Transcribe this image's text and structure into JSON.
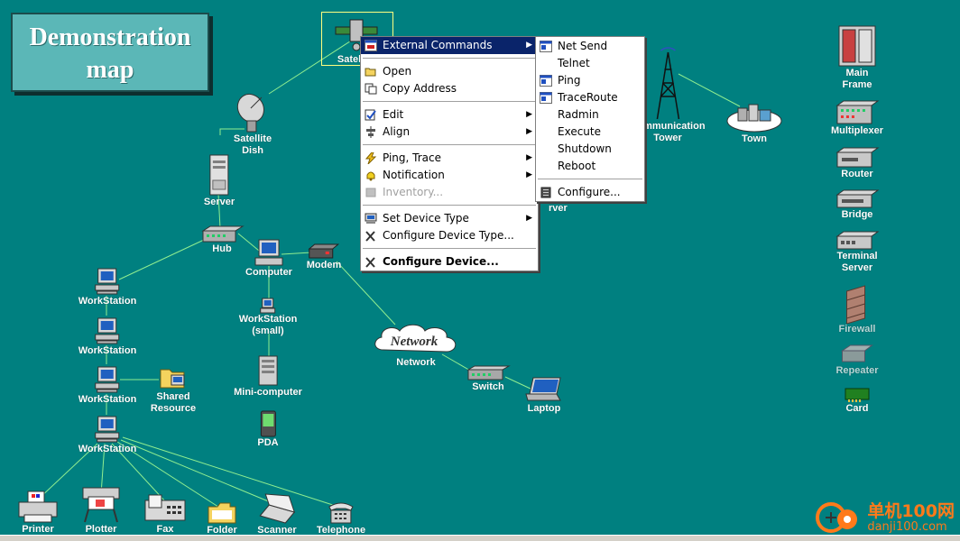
{
  "title": "Demonstration\nmap",
  "colors": {
    "background": "#008080",
    "menu_highlight": "#0a246a",
    "link": "#90ee90",
    "selection": "#ffff80"
  },
  "nodes": {
    "satellite": "Satellite",
    "satellite_dish": "Satellite\nDish",
    "server": "Server",
    "hub": "Hub",
    "computer": "Computer",
    "modem": "Modem",
    "ws1": "WorkStation",
    "ws2": "WorkStation",
    "ws3": "WorkStation",
    "ws4": "WorkStation",
    "shared_resource": "Shared\nResource",
    "ws_small": "WorkStation\n(small)",
    "minicomputer": "Mini-computer",
    "pda": "PDA",
    "network_cloud": "Network",
    "network": "Network",
    "switch": "Switch",
    "laptop": "Laptop",
    "comm_tower": "Communication\nTower",
    "town": "Town",
    "server_partial": "rver",
    "printer": "Printer",
    "plotter": "Plotter",
    "fax": "Fax",
    "folder": "Folder",
    "scanner": "Scanner",
    "telephone": "Telephone"
  },
  "palette": {
    "main_frame": "Main\nFrame",
    "multiplexer": "Multiplexer",
    "router": "Router",
    "bridge": "Bridge",
    "terminal_server": "Terminal\nServer",
    "firewall": "Firewall",
    "repeater": "Repeater",
    "card": "Card"
  },
  "context_menu": {
    "items": [
      {
        "label": "External Commands",
        "icon": "external-commands-icon",
        "submenu": true,
        "highlighted": true
      },
      {
        "label": "Open",
        "icon": "folder-open-icon"
      },
      {
        "label": "Copy Address",
        "icon": "copy-icon"
      },
      {
        "label": "Edit",
        "icon": "edit-icon",
        "submenu": true
      },
      {
        "label": "Align",
        "icon": "align-icon",
        "submenu": true
      },
      {
        "label": "Ping, Trace",
        "icon": "lightning-icon",
        "submenu": true
      },
      {
        "label": "Notification",
        "icon": "bell-icon",
        "submenu": true
      },
      {
        "label": "Inventory...",
        "icon": "inventory-icon",
        "disabled": true
      },
      {
        "label": "Set Device Type",
        "icon": "device-type-icon",
        "submenu": true
      },
      {
        "label": "Configure Device Type...",
        "icon": "tools-icon"
      },
      {
        "label": "Configure Device...",
        "icon": "tools-icon",
        "bold": true
      }
    ]
  },
  "submenu": {
    "items": [
      {
        "label": "Net Send",
        "icon": "window-icon"
      },
      {
        "label": "Telnet"
      },
      {
        "label": "Ping",
        "icon": "window-icon"
      },
      {
        "label": "TraceRoute",
        "icon": "window-icon"
      },
      {
        "label": "Radmin"
      },
      {
        "label": "Execute"
      },
      {
        "label": "Shutdown"
      },
      {
        "label": "Reboot"
      },
      {
        "label": "Configure...",
        "icon": "configure-icon"
      }
    ]
  },
  "watermark": {
    "site_name": "单机100网",
    "site_url": "danji100.com"
  }
}
